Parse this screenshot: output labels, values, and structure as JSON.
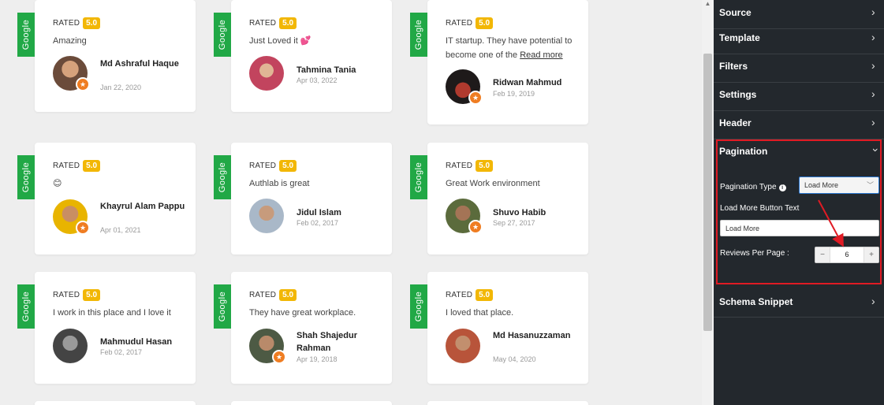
{
  "reviews": [
    {
      "source": "Google",
      "rated_label": "RATED",
      "score": "5.0",
      "text": "Amazing",
      "name": "Md Ashraful Haque",
      "date": "Jan 22, 2020",
      "avatar_color": "#6b4b3a"
    },
    {
      "source": "Google",
      "rated_label": "RATED",
      "score": "5.0",
      "text": "Just Loved it 💕",
      "name": "Tahmina Tania",
      "date": "Apr 03, 2022",
      "avatar_color": "#c2445e"
    },
    {
      "source": "Google",
      "rated_label": "RATED",
      "score": "5.0",
      "text": "IT startup. They have potential to become one of the",
      "read_more": "Read more",
      "name": "Ridwan Mahmud",
      "date": "Feb 19, 2019",
      "avatar_color": "#1e1a1a"
    },
    {
      "source": "Google",
      "rated_label": "RATED",
      "score": "5.0",
      "text": "😊",
      "name": "Khayrul Alam Pappu",
      "date": "Apr 01, 2021",
      "avatar_color": "#e8b400"
    },
    {
      "source": "Google",
      "rated_label": "RATED",
      "score": "5.0",
      "text": "Authlab is great",
      "name": "Jidul Islam",
      "date": "Feb 02, 2017",
      "avatar_color": "#a9b8c8"
    },
    {
      "source": "Google",
      "rated_label": "RATED",
      "score": "5.0",
      "text": "Great Work environment",
      "name": "Shuvo Habib",
      "date": "Sep 27, 2017",
      "avatar_color": "#5b6b3c"
    },
    {
      "source": "Google",
      "rated_label": "RATED",
      "score": "5.0",
      "text": "I work in this place and I love it",
      "name": "Mahmudul Hasan",
      "date": "Feb 02, 2017",
      "avatar_color": "#444444"
    },
    {
      "source": "Google",
      "rated_label": "RATED",
      "score": "5.0",
      "text": "They have great workplace.",
      "name": "Shah Shajedur Rahman",
      "date": "Apr 19, 2018",
      "avatar_color": "#4d5a44"
    },
    {
      "source": "Google",
      "rated_label": "RATED",
      "score": "5.0",
      "text": "I loved that place.",
      "name": "Md Hasanuzzaman",
      "date": "May 04, 2020",
      "avatar_color": "#b8543a"
    }
  ],
  "panel": {
    "sections": [
      "Source",
      "Template",
      "Filters",
      "Settings",
      "Header"
    ],
    "pagination": {
      "title": "Pagination",
      "type_label": "Pagination Type",
      "type_value": "Load More",
      "button_text_label": "Load More Button Text",
      "button_text_value": "Load More",
      "per_page_label": "Reviews Per Page :",
      "per_page_value": "6",
      "minus": "−",
      "plus": "+"
    },
    "after_sections": [
      "Schema Snippet"
    ]
  },
  "colors": {
    "google_green": "#21a846",
    "rating_badge": "#f2b705",
    "panel_bg": "#23282d",
    "highlight_border": "#e01b24",
    "annotation_arrow": "#e01b24"
  },
  "icons": {
    "section_toggle": "chevron-right-icon",
    "expanded_toggle": "chevron-down-icon",
    "info": "info-icon",
    "dropdown": "chevron-down-icon"
  }
}
